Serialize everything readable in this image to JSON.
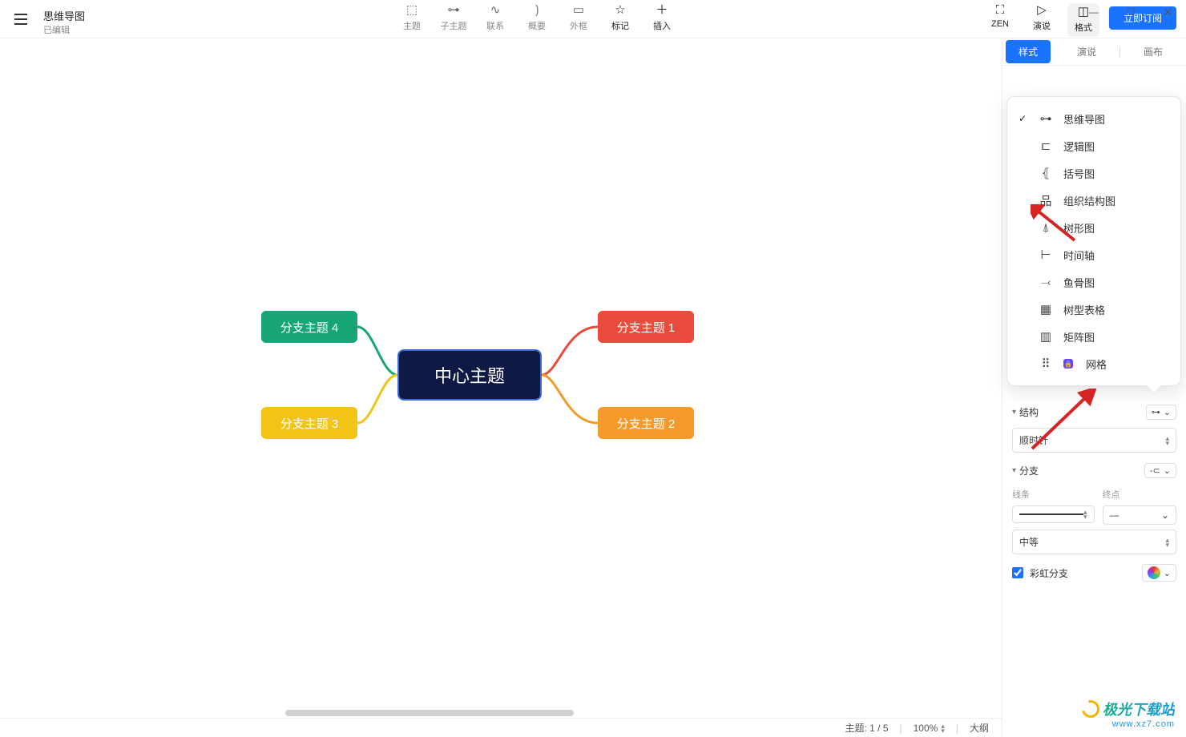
{
  "header": {
    "title": "思维导图",
    "subtitle": "已编辑",
    "tools": [
      {
        "label": "主题",
        "icon": "⬚"
      },
      {
        "label": "子主题",
        "icon": "⊶"
      },
      {
        "label": "联系",
        "icon": "∿"
      },
      {
        "label": "概要",
        "icon": "⟯"
      },
      {
        "label": "外框",
        "icon": "▭"
      },
      {
        "label": "标记",
        "icon": "☆",
        "dark": true
      },
      {
        "label": "插入",
        "icon": "＋",
        "dark": true
      }
    ],
    "right_tools": [
      {
        "label": "ZEN",
        "icon": "⛶"
      },
      {
        "label": "演说",
        "icon": "▷"
      },
      {
        "label": "格式",
        "icon": "◫",
        "boxed": true
      }
    ],
    "subscribe": "立即订阅"
  },
  "mindmap": {
    "central": "中心主题",
    "nodes": {
      "tl": "分支主题 4",
      "bl": "分支主题 3",
      "tr": "分支主题 1",
      "br": "分支主题 2"
    }
  },
  "panel": {
    "tabs": {
      "style": "样式",
      "pitch": "演说",
      "canvas": "画布"
    },
    "structures": [
      {
        "label": "思维导图",
        "icon": "⊶",
        "checked": true
      },
      {
        "label": "逻辑图",
        "icon": "⊏"
      },
      {
        "label": "括号图",
        "icon": "⦃"
      },
      {
        "label": "组织结构图",
        "icon": "品"
      },
      {
        "label": "树形图",
        "icon": "⍋"
      },
      {
        "label": "时间轴",
        "icon": "⊢"
      },
      {
        "label": "鱼骨图",
        "icon": "⤙"
      },
      {
        "label": "树型表格",
        "icon": "▦"
      },
      {
        "label": "矩阵图",
        "icon": "▥"
      },
      {
        "label": "网格",
        "icon": "⠿",
        "pro": true
      }
    ],
    "section_structure": {
      "title": "结构",
      "direction": "顺时针"
    },
    "section_branch": {
      "title": "分支",
      "line_label": "线条",
      "end_label": "终点",
      "end_value": "—",
      "weight": "中等",
      "rainbow": "彩虹分支"
    }
  },
  "statusbar": {
    "topic": "主题: 1 / 5",
    "zoom": "100%",
    "outline": "大纲"
  },
  "watermark": {
    "brand": "极光下载站",
    "url": "www.xz7.com"
  }
}
